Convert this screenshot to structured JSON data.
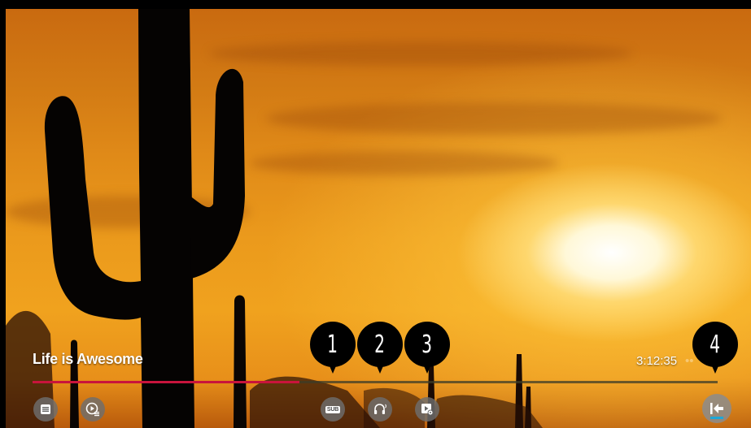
{
  "player": {
    "title": "Life is Awesome",
    "time_total": "3:12:35",
    "time_current": "",
    "progress": 0.39,
    "buffered": 1.0,
    "colors": {
      "progress": "#c8143c",
      "track": "#3c3c28",
      "focus_underline": "#1ea7d8"
    }
  },
  "controls": {
    "left": [
      {
        "id": "playlist",
        "icon": "list-icon"
      },
      {
        "id": "play_settings",
        "icon": "play-settings-icon"
      }
    ],
    "center": [
      {
        "id": "subtitles",
        "icon": "subtitle-icon",
        "label": "SUB"
      },
      {
        "id": "audio_track",
        "icon": "headphones-icon"
      },
      {
        "id": "video_settings",
        "icon": "video-settings-icon"
      }
    ],
    "right": [
      {
        "id": "back",
        "icon": "back-to-start-icon"
      }
    ]
  },
  "callouts": [
    "1",
    "2",
    "3",
    "4"
  ]
}
